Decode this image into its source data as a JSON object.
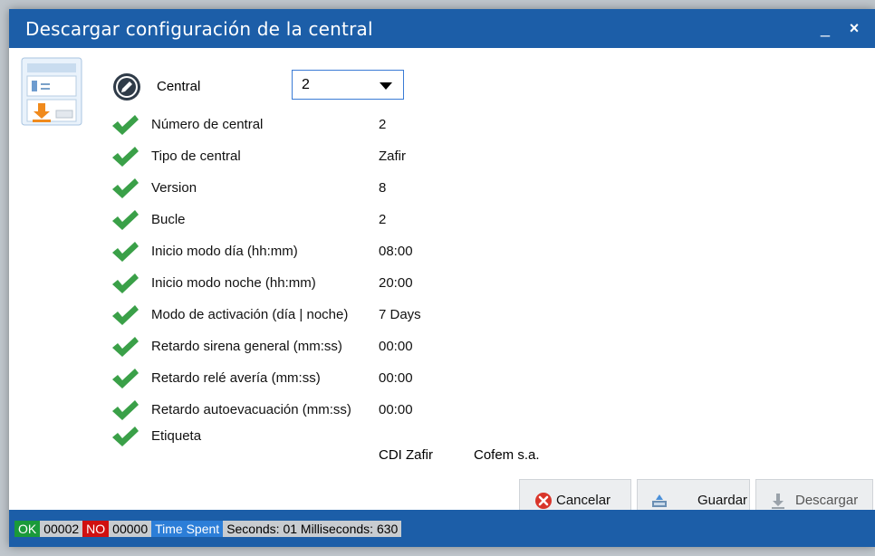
{
  "window": {
    "title": "Descargar configuración de la central",
    "minimize": "_",
    "close": "×"
  },
  "central": {
    "label": "Central",
    "selected": "2"
  },
  "rows": [
    {
      "label": "Número de central",
      "value": "2"
    },
    {
      "label": "Tipo de central",
      "value": "Zafir"
    },
    {
      "label": "Version",
      "value": "8"
    },
    {
      "label": "Bucle",
      "value": "2"
    },
    {
      "label": "Inicio modo día (hh:mm)",
      "value": "08:00"
    },
    {
      "label": "Inicio modo noche (hh:mm)",
      "value": "20:00"
    },
    {
      "label": "Modo de activación (día | noche)",
      "value": "7 Days"
    },
    {
      "label": "Retardo sirena general (mm:ss)",
      "value": "00:00"
    },
    {
      "label": "Retardo relé avería (mm:ss)",
      "value": "00:00"
    },
    {
      "label": "Retardo autoevacuación (mm:ss)",
      "value": "00:00"
    },
    {
      "label": "Etiqueta",
      "value": ""
    }
  ],
  "etiqueta": {
    "part1": "CDI Zafir",
    "part2": "Cofem s.a."
  },
  "buttons": {
    "cancel": "Cancelar",
    "save": "Guardar",
    "download": "Descargar"
  },
  "status": {
    "ok_label": "OK",
    "ok_count": "00002",
    "no_label": "NO",
    "no_count": "00000",
    "time_label": "Time Spent",
    "time_value": "Seconds: 01 Milliseconds: 630"
  },
  "colors": {
    "titlebar": "#1c5ea8",
    "check": "#3aa048",
    "ok": "#1a9a3a",
    "no": "#d01010",
    "time": "#2c7ed8"
  }
}
